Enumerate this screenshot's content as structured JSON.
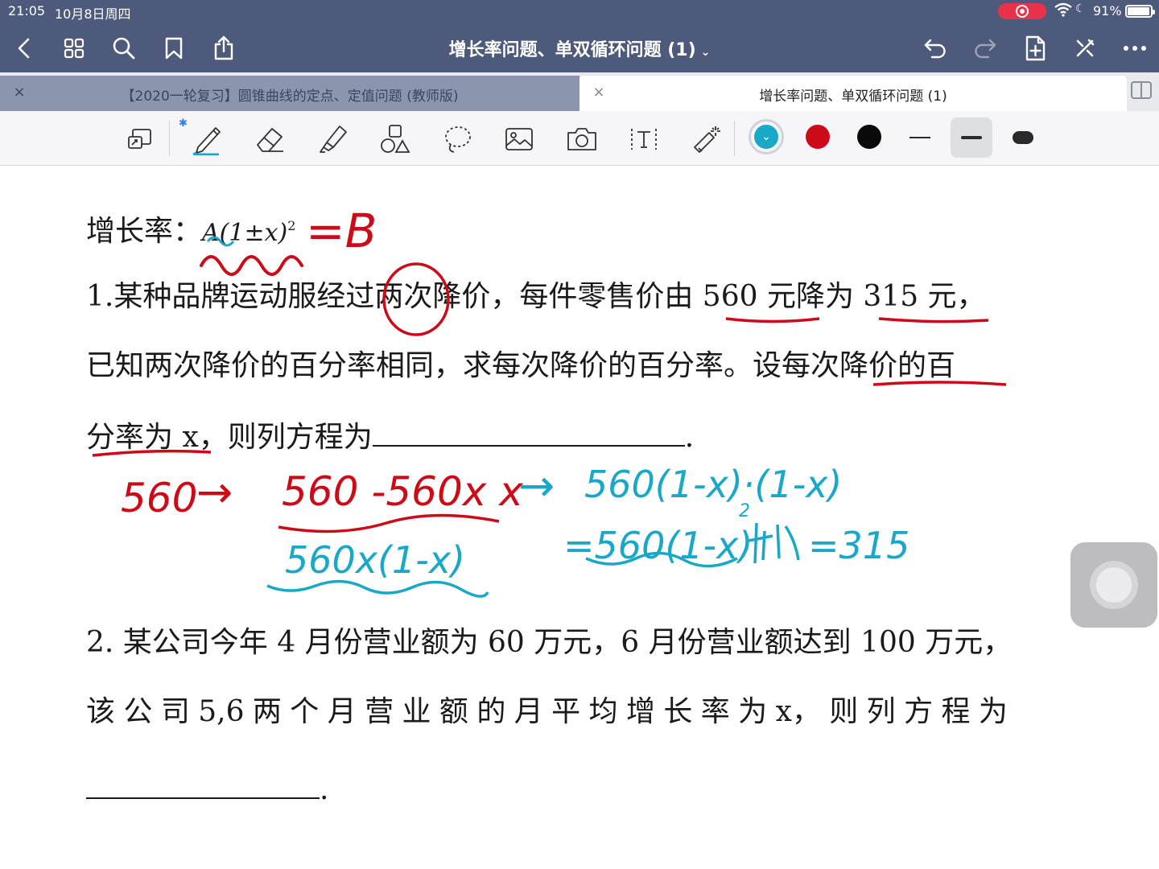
{
  "status_bar": {
    "time": "21:05",
    "date": "10月8日周四",
    "battery": "91%"
  },
  "nav": {
    "title": "增长率问题、单双循环问题 (1)"
  },
  "tabs": [
    {
      "label": "【2020一轮复习】圆锥曲线的定点、定值问题 (教师版)",
      "active": false
    },
    {
      "label": "增长率问题、单双循环问题 (1)",
      "active": true
    }
  ],
  "toolbar": {
    "tools": [
      "lasso-resize-icon",
      "pen-icon",
      "eraser-icon",
      "highlighter-icon",
      "shapes-icon",
      "lasso-icon",
      "image-icon",
      "camera-icon",
      "text-icon",
      "laser-pointer-icon"
    ],
    "colors": [
      "#19a8c7",
      "#cc0a18",
      "#0a0a0a"
    ]
  },
  "document": {
    "formula_label": "增长率：",
    "formula": "A(1±x)",
    "q1_line1": "1.某种品牌运动服经过两次降价，每件零售价由 560 元降为 315 元，",
    "q1_line2": "已知两次降价的百分率相同，求每次降价的百分率。设每次降价的百",
    "q1_line3": "分率为 x，则列方程为",
    "q2_line1": "2. 某公司今年 4 月份营业额为 60 万元，6 月份营业额达到 100 万元，",
    "q2_line2": [
      "该",
      "公",
      "司",
      "5,6",
      "两",
      "个",
      "月",
      "营",
      "业",
      "额",
      "的",
      "月",
      "平",
      "均",
      "增",
      "长",
      "率",
      "为",
      "x，",
      "则",
      "列",
      "方",
      "程",
      "为"
    ]
  },
  "handwriting": {
    "eq_b": "=B",
    "start": "560",
    "arrow": "→",
    "after_first": "560 -560x x",
    "after_first_simplified": "560x(1-x)",
    "arrow2": "→",
    "cyan_line1": "560(1-x)·(1-x)",
    "cyan_line2": "=560(1-x)",
    "cyan_exp": "2",
    "cyan_end": "=315"
  }
}
